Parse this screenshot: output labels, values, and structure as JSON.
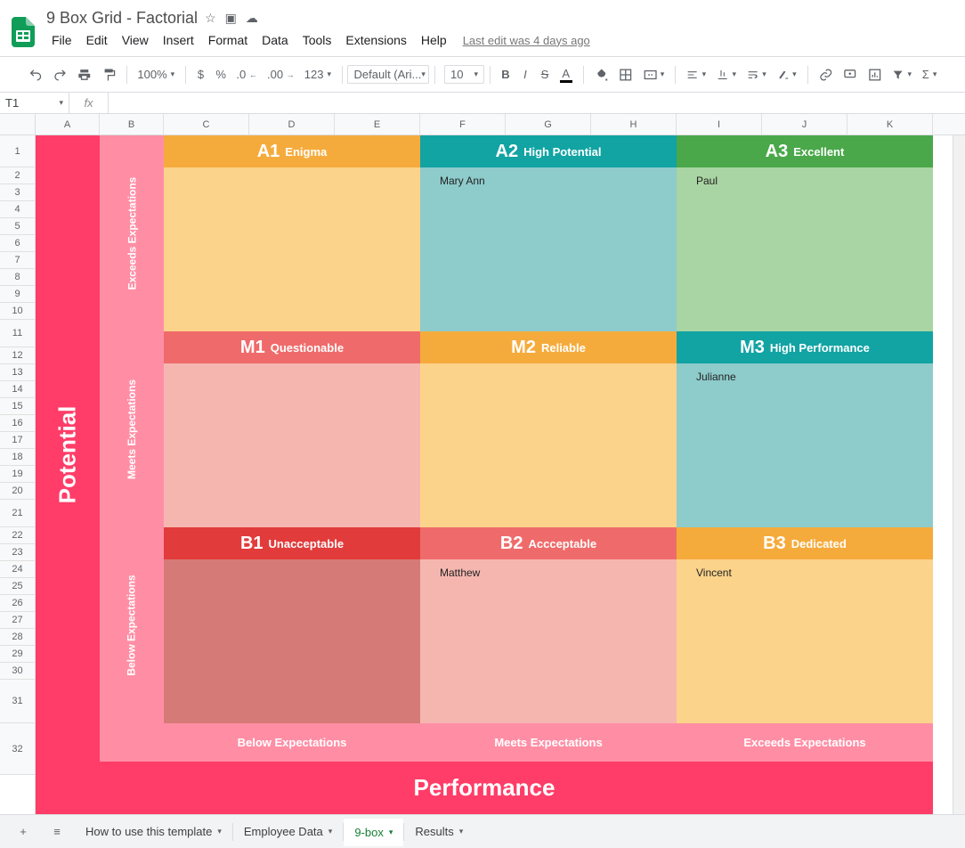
{
  "doc": {
    "title": "9 Box Grid - Factorial",
    "last_edit": "Last edit was 4 days ago"
  },
  "menus": [
    "File",
    "Edit",
    "View",
    "Insert",
    "Format",
    "Data",
    "Tools",
    "Extensions",
    "Help"
  ],
  "toolbar": {
    "zoom": "100%",
    "font": "Default (Ari...",
    "font_size": "10"
  },
  "namebox": "T1",
  "columns": [
    "A",
    "B",
    "C",
    "D",
    "E",
    "F",
    "G",
    "H",
    "I",
    "J",
    "K"
  ],
  "rows": [
    "1",
    "2",
    "3",
    "4",
    "5",
    "6",
    "7",
    "8",
    "9",
    "10",
    "11",
    "12",
    "13",
    "14",
    "15",
    "16",
    "17",
    "18",
    "19",
    "20",
    "21",
    "22",
    "23",
    "24",
    "25",
    "26",
    "27",
    "28",
    "29",
    "30",
    "31",
    "32"
  ],
  "axes": {
    "y_title": "Potential",
    "y_labels": [
      "Exceeds Expectations",
      "Meets Expectations",
      "Below Expectations"
    ],
    "x_title": "Performance",
    "x_labels": [
      "Below Expectations",
      "Meets Expectations",
      "Exceeds Expectations"
    ]
  },
  "boxes": {
    "A1": {
      "code": "A1",
      "label": "Enigma",
      "head": "#f5ab3c",
      "body": "#fbd38a",
      "names": []
    },
    "A2": {
      "code": "A2",
      "label": "High Potential",
      "head": "#12a3a3",
      "body": "#8ecbcb",
      "names": [
        "Mary Ann"
      ]
    },
    "A3": {
      "code": "A3",
      "label": "Excellent",
      "head": "#4aa84a",
      "body": "#a9d4a3",
      "names": [
        "Paul"
      ]
    },
    "M1": {
      "code": "M1",
      "label": "Questionable",
      "head": "#ef6b6b",
      "body": "#f6b6b0",
      "names": []
    },
    "M2": {
      "code": "M2",
      "label": "Reliable",
      "head": "#f5ab3c",
      "body": "#fbd38a",
      "names": []
    },
    "M3": {
      "code": "M3",
      "label": "High Performance",
      "head": "#12a3a3",
      "body": "#8ecbcb",
      "names": [
        "Julianne"
      ]
    },
    "B1": {
      "code": "B1",
      "label": "Unacceptable",
      "head": "#e23b3b",
      "body": "#d57a77",
      "names": []
    },
    "B2": {
      "code": "B2",
      "label": "Accceptable",
      "head": "#ef6b6b",
      "body": "#f6b6b0",
      "names": [
        "Matthew"
      ]
    },
    "B3": {
      "code": "B3",
      "label": "Dedicated",
      "head": "#f5ab3c",
      "body": "#fbd38a",
      "names": [
        "Vincent"
      ]
    }
  },
  "tabs": {
    "items": [
      "How to use this template",
      "Employee Data",
      "9-box",
      "Results"
    ],
    "active_index": 2
  }
}
